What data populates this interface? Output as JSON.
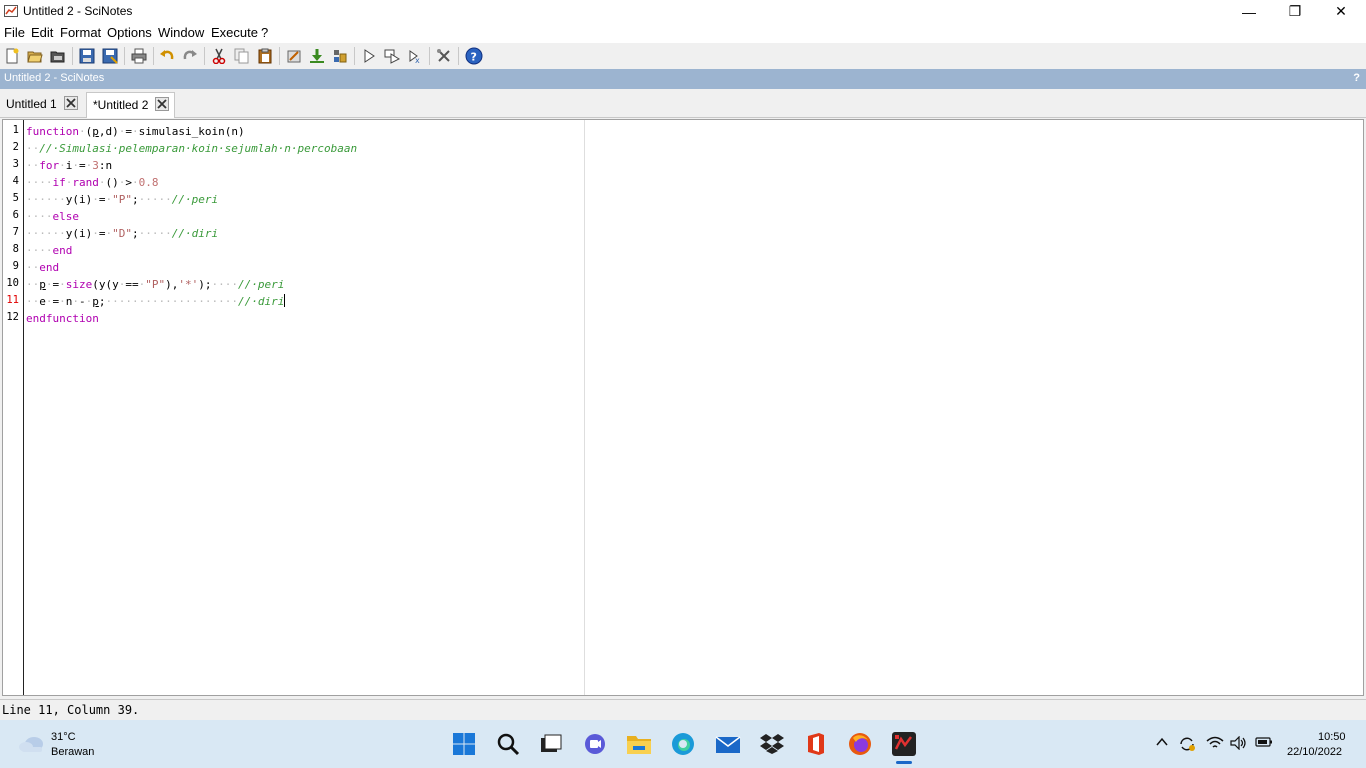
{
  "window": {
    "title": "Untitled 2 - SciNotes",
    "minimize": "—",
    "maximize": "❐",
    "close": "✕"
  },
  "menu": [
    "File",
    "Edit",
    "Format",
    "Options",
    "Window",
    "Execute",
    "?"
  ],
  "panel": {
    "title": "Untitled 2 - SciNotes",
    "help": "?"
  },
  "tabs": [
    {
      "label": "Untitled 1"
    },
    {
      "label": "*Untitled 2"
    }
  ],
  "editor": {
    "line_numbers": [
      "1",
      "2",
      "3",
      "4",
      "5",
      "6",
      "7",
      "8",
      "9",
      "10",
      "11",
      "12"
    ],
    "current_line": 11
  },
  "status": {
    "text": "Line 11, Column 39."
  },
  "taskbar": {
    "weather_temp": "31°C",
    "weather_desc": "Berawan",
    "time": "10:50",
    "date": "22/10/2022"
  },
  "icons": {
    "toolbar": [
      "new-file-icon",
      "open-file-icon",
      "open-folder-icon",
      "save-icon",
      "save-as-icon",
      "print-icon",
      "undo-icon",
      "redo-icon",
      "cut-icon",
      "copy-icon",
      "paste-icon",
      "preferences-icon",
      "execute-save-icon",
      "load-variables-icon",
      "run-icon",
      "run-step-icon",
      "run-all-icon",
      "tools-icon",
      "help-icon"
    ]
  }
}
